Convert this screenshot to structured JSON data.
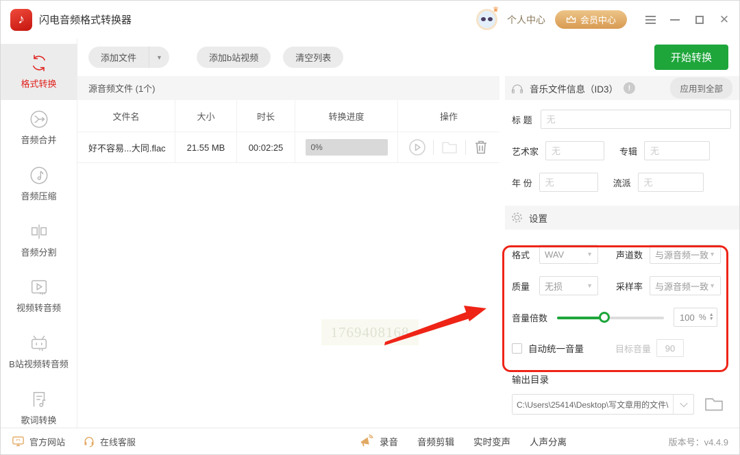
{
  "titlebar": {
    "title": "闪电音频格式转换器",
    "personal_center": "个人中心",
    "member_center": "会员中心"
  },
  "sidebar": {
    "items": [
      {
        "label": "格式转换",
        "active": true
      },
      {
        "label": "音频合并",
        "active": false
      },
      {
        "label": "音频压缩",
        "active": false
      },
      {
        "label": "音频分割",
        "active": false
      },
      {
        "label": "视频转音频",
        "active": false
      },
      {
        "label": "B站视频转音频",
        "active": false
      },
      {
        "label": "歌词转换",
        "active": false
      }
    ]
  },
  "toolbar": {
    "add_file": "添加文件",
    "add_bilibili": "添加b站视频",
    "clear_list": "清空列表",
    "start_convert": "开始转换"
  },
  "file_list": {
    "section_title": "源音频文件 (1个)",
    "columns": [
      "文件名",
      "大小",
      "时长",
      "转换进度",
      "操作"
    ],
    "rows": [
      {
        "name": "好不容易...大同.flac",
        "size": "21.55 MB",
        "duration": "00:02:25",
        "progress": "0%"
      }
    ]
  },
  "id3": {
    "title": "音乐文件信息（ID3）",
    "apply_all": "应用到全部",
    "title_label": "标 题",
    "artist_label": "艺术家",
    "album_label": "专辑",
    "year_label": "年 份",
    "genre_label": "流派",
    "placeholder": "无"
  },
  "settings": {
    "title": "设置",
    "format_label": "格式",
    "format_value": "WAV",
    "channels_label": "声道数",
    "channels_value": "与源音频一致",
    "quality_label": "质量",
    "quality_value": "无损",
    "samplerate_label": "采样率",
    "samplerate_value": "与源音频一致",
    "volume_label": "音量倍数",
    "volume_value": "100",
    "volume_unit": "%",
    "auto_volume_label": "自动统一音量",
    "target_volume_label": "目标音量",
    "target_volume_value": "90"
  },
  "output": {
    "label": "输出目录",
    "path": "C:\\Users\\25414\\Desktop\\写文章用的文件\\..."
  },
  "statusbar": {
    "website": "官方网站",
    "support": "在线客服",
    "record": "录音",
    "audio_edit": "音频剪辑",
    "voice_change": "实时变声",
    "vocal_separation": "人声分离",
    "version": "版本号：v4.4.9"
  },
  "annotation": {
    "watermark": "1769408168"
  },
  "colors": {
    "accent_red": "#e0231e",
    "annotation_red": "#ee2417",
    "green": "#1ea63b",
    "gold": "#d89a52"
  }
}
